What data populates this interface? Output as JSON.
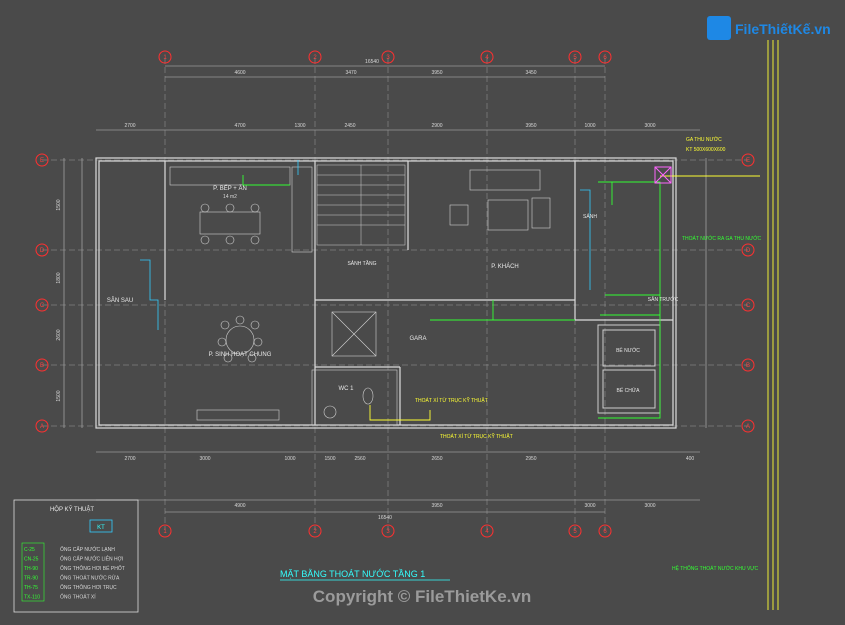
{
  "watermark": {
    "logo_text": "FileThiếtKế.vn",
    "copyright": "Copyright © FileThietKe.vn"
  },
  "title": "MẶT BẰNG THOÁT NƯỚC TẦNG 1",
  "grid_top": [
    "1",
    "2",
    "3",
    "4",
    "5",
    "6"
  ],
  "grid_left": [
    "E",
    "D",
    "C",
    "B",
    "A"
  ],
  "grid_right": [
    "E",
    "D",
    "C",
    "B",
    "A"
  ],
  "dims_top_total": "16540",
  "dims_top_row1": [
    "4600",
    "3470",
    "3950",
    "3450"
  ],
  "dims_top_row2": [
    "2700",
    "4700",
    "1300",
    "2450",
    "2900",
    "3950",
    "1000",
    "3000"
  ],
  "dims_bottom_row1": [
    "2700",
    "3000",
    "1000",
    "1500",
    "2560",
    "2650",
    "2950",
    "400"
  ],
  "dims_bottom_row2": [
    "4900",
    "3950",
    "3000",
    "3000"
  ],
  "dims_bottom_total": "16540",
  "dims_left": [
    "1500",
    "1800",
    "2600",
    "1500"
  ],
  "rooms": {
    "kitchen": "P. BẾP + ĂN",
    "kitchen_area": "14 m2",
    "stair_hall": "SẢNH TẦNG",
    "living": "P. KHÁCH",
    "family": "P. SINH HOẠT CHUNG",
    "back_yard": "SÂN SAU",
    "garage": "GARA",
    "wc": "WC 1",
    "lobby": "SẢNH",
    "front_yard": "SÂN TRƯỚC",
    "tank1": "BỂ NƯỚC",
    "tank2": "BỂ CHỨA",
    "manhole": "GA THU NƯỚC",
    "manhole_size": "KT 500X600X600"
  },
  "notes": {
    "n1": "THOÁT XÍ TỪ TRỤC KỸ THUẬT",
    "n2": "THOÁT NƯỚC RA GA THU NƯỚC",
    "n3": "HỆ THỐNG THOÁT NƯỚC KHU VỰC"
  },
  "legend": {
    "title": "HỘP KỸ THUẬT",
    "badge": "KT",
    "items": [
      {
        "code": "C-25",
        "label": "ỐNG CẤP NƯỚC LẠNH"
      },
      {
        "code": "CN-25",
        "label": "ỐNG CẤP NƯỚC LIÊN HỢI"
      },
      {
        "code": "TH-90",
        "label": "ỐNG THÔNG HƠI BỂ PHỐT"
      },
      {
        "code": "TR-90",
        "label": "ỐNG THOÁT NƯỚC RỬA"
      },
      {
        "code": "TH-75",
        "label": "ỐNG THÔNG HƠI TRỤC"
      },
      {
        "code": "TX-110",
        "label": "ỐNG THOÁT XÍ"
      }
    ]
  },
  "colors": {
    "background": "#4a4a4a",
    "wall": "#dcdcdc",
    "axis": "#ff3030",
    "drain": "#33ff33",
    "pipe": "#ffff33",
    "water": "#33ccff",
    "title": "#33ffff"
  }
}
